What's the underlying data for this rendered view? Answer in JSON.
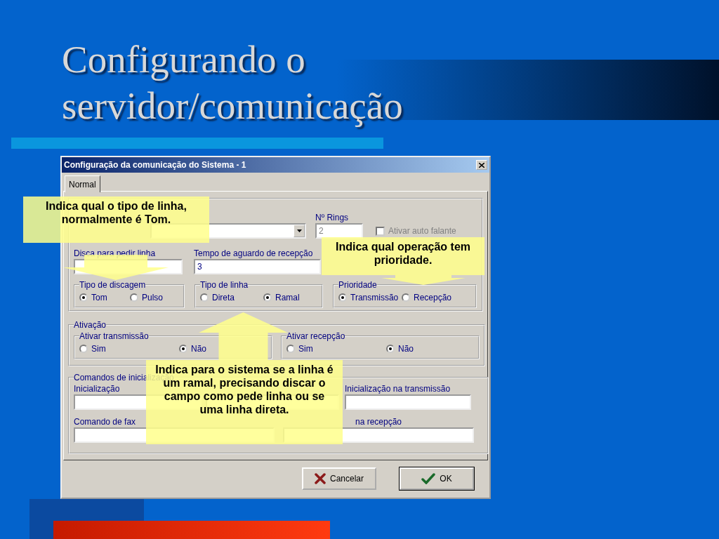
{
  "slide": {
    "title_lines": [
      "Configurando o",
      "servidor/comunicação"
    ]
  },
  "dialog": {
    "title": "Configuração da comunicação do Sistema - 1",
    "tabs": [
      {
        "label": "Normal",
        "selected": true
      }
    ],
    "communication": {
      "rings": {
        "label": "Nº Rings",
        "value": "2"
      },
      "speaker": {
        "label": "Ativar auto falante",
        "checked": false
      },
      "fields": [
        {
          "label": "Disca para pedir linha"
        },
        {
          "label": "Tempo de aguardo de recepção",
          "value": "3"
        }
      ],
      "radio_groups": [
        {
          "label": "Tipo de discagem",
          "options": [
            {
              "label": "Tom",
              "selected": true
            },
            {
              "label": "Pulso",
              "selected": false
            }
          ]
        },
        {
          "label": "Tipo de linha",
          "options": [
            {
              "label": "Direta",
              "selected": false
            },
            {
              "label": "Ramal",
              "selected": true
            }
          ]
        },
        {
          "label": "Prioridade",
          "options": [
            {
              "label": "Transmissão",
              "selected": true
            },
            {
              "label": "Recepção",
              "selected": false
            }
          ]
        }
      ]
    },
    "activation": {
      "label": "Ativação",
      "radio_groups": [
        {
          "label": "Ativar transmissão",
          "options": [
            {
              "label": "Sim",
              "selected": false
            },
            {
              "label": "Não",
              "selected": true
            }
          ]
        },
        {
          "label": "Ativar recepção",
          "options": [
            {
              "label": "Sim",
              "selected": false
            },
            {
              "label": "Não",
              "selected": true
            }
          ]
        }
      ]
    },
    "init_commands": {
      "label": "Comandos de inicialização",
      "fields": [
        {
          "kind": "labeled",
          "label": "Inicialização"
        },
        {
          "kind": "unlabeled"
        },
        {
          "kind": "labeled",
          "label": "Inicialização na transmissão"
        },
        {
          "kind": "labeled",
          "label": "Comando de fax"
        },
        {
          "kind": "labeled",
          "label": "na recepção"
        }
      ]
    },
    "buttons": [
      {
        "label": "Cancelar",
        "kind": "cancel"
      },
      {
        "label": "OK",
        "kind": "ok"
      }
    ]
  },
  "callouts": [
    {
      "text": "Indica qual o tipo de linha, normalmente é Tom.",
      "kind": "down"
    },
    {
      "text": "Indica qual operação tem prioridade.",
      "kind": "down"
    },
    {
      "text": "Indica para o sistema se a linha é um ramal, precisando discar o campo como pede linha ou se uma linha direta.",
      "kind": "up"
    }
  ]
}
